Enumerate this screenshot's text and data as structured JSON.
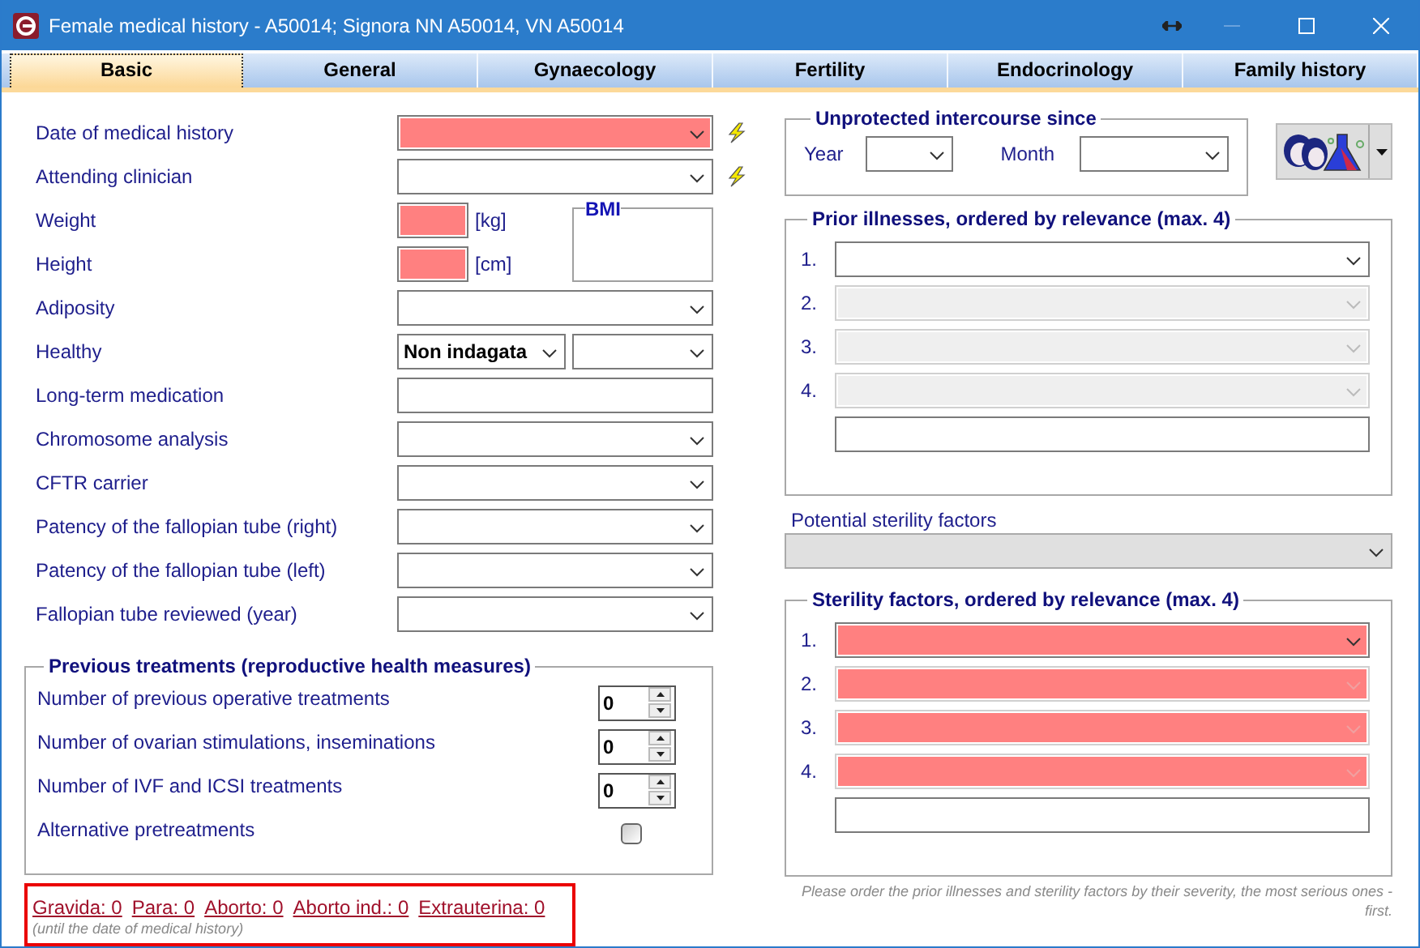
{
  "window": {
    "title": "Female medical history - A50014; Signora NN A50014, VN A50014"
  },
  "tabs": [
    {
      "label": "Basic",
      "selected": true
    },
    {
      "label": "General",
      "selected": false
    },
    {
      "label": "Gynaecology",
      "selected": false
    },
    {
      "label": "Fertility",
      "selected": false
    },
    {
      "label": "Endocrinology",
      "selected": false
    },
    {
      "label": "Family history",
      "selected": false
    }
  ],
  "left_fields": [
    {
      "label": "Date of medical history",
      "kind": "select",
      "required": true,
      "warning": true
    },
    {
      "label": "Attending clinician",
      "kind": "select",
      "required": false,
      "warning": true
    },
    {
      "label": "Weight",
      "kind": "unit",
      "unit": "[kg]",
      "required": true,
      "warning": false
    },
    {
      "label": "Height",
      "kind": "unit",
      "unit": "[cm]",
      "required": true,
      "warning": false
    },
    {
      "label": "Adiposity",
      "kind": "select",
      "required": false,
      "warning": false
    },
    {
      "label": "Healthy",
      "kind": "double",
      "value": "Non indagata",
      "required": false,
      "warning": false
    },
    {
      "label": "Long-term medication",
      "kind": "text",
      "required": false,
      "warning": false
    },
    {
      "label": "Chromosome analysis",
      "kind": "select",
      "required": false,
      "warning": false
    },
    {
      "label": "CFTR carrier",
      "kind": "select",
      "required": false,
      "warning": false
    },
    {
      "label": "Patency of the fallopian tube (right)",
      "kind": "select",
      "required": false,
      "warning": false
    },
    {
      "label": "Patency of the fallopian tube (left)",
      "kind": "select",
      "required": false,
      "warning": false
    },
    {
      "label": "Fallopian tube reviewed (year)",
      "kind": "select",
      "required": false,
      "warning": false
    }
  ],
  "bmi": {
    "label": "BMI"
  },
  "previous_treatments": {
    "title": "Previous treatments (reproductive health measures)",
    "items": [
      {
        "label": "Number of previous operative treatments",
        "kind": "spinner",
        "value": "0"
      },
      {
        "label": "Number of ovarian stimulations, inseminations",
        "kind": "spinner",
        "value": "0"
      },
      {
        "label": "Number of IVF and ICSI treatments",
        "kind": "spinner",
        "value": "0"
      },
      {
        "label": "Alternative pretreatments",
        "kind": "checkbox",
        "checked": false
      }
    ]
  },
  "obstetric_summary": {
    "items": [
      "Gravida: 0",
      "Para: 0",
      "Aborto: 0",
      "Aborto ind.: 0",
      "Extrauterina: 0"
    ],
    "note": "(until the date of medical history)"
  },
  "unprotected_intercourse": {
    "title": "Unprotected intercourse since",
    "year_label": "Year",
    "month_label": "Month"
  },
  "prior_illnesses": {
    "title": "Prior illnesses, ordered by relevance (max. 4)",
    "rows": [
      {
        "number": "1.",
        "disabled": false,
        "required": false
      },
      {
        "number": "2.",
        "disabled": true,
        "required": false
      },
      {
        "number": "3.",
        "disabled": true,
        "required": false
      },
      {
        "number": "4.",
        "disabled": true,
        "required": false
      }
    ]
  },
  "potential_sterility_factors": {
    "label": "Potential sterility factors",
    "disabled": true
  },
  "sterility_factors": {
    "title": "Sterility factors, ordered by relevance (max. 4)",
    "rows": [
      {
        "number": "1.",
        "disabled": false,
        "required": true
      },
      {
        "number": "2.",
        "disabled": true,
        "required": true
      },
      {
        "number": "3.",
        "disabled": true,
        "required": true
      },
      {
        "number": "4.",
        "disabled": true,
        "required": true
      }
    ]
  },
  "hint": "Please order the prior illnesses and sterility factors by their severity, the most serious ones - first."
}
